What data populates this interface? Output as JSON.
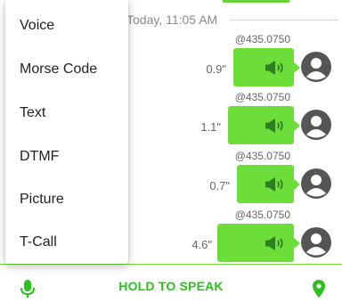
{
  "chat": {
    "date_separator": "Today, 11:05 AM",
    "messages": [
      {
        "sender": "@435.0750",
        "duration": "0.9\""
      },
      {
        "sender": "@435.0750",
        "duration": "1.1\""
      },
      {
        "sender": "@435.0750",
        "duration": "0.7\""
      },
      {
        "sender": "@435.0750",
        "duration": "4.6\""
      }
    ]
  },
  "menu": {
    "items": [
      "Voice",
      "Morse Code",
      "Text",
      "DTMF",
      "Picture",
      "T-Call"
    ]
  },
  "bottom_bar": {
    "hold_label": "HOLD TO SPEAK"
  },
  "icons": {
    "voice": "voice-wave-icon",
    "avatar": "user-avatar-icon",
    "mic": "microphone-icon",
    "location": "location-pin-icon"
  },
  "colors": {
    "accent": "#6ddd3a",
    "label": "#2cc01e",
    "avatar": "#555555"
  }
}
